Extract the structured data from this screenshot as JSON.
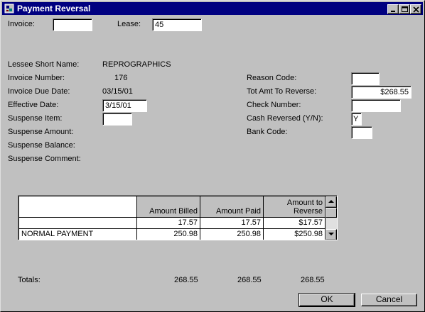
{
  "window": {
    "title": "Payment Reversal",
    "minimize_icon": "minimize-icon",
    "maximize_icon": "maximize-icon",
    "close_icon": "close-icon"
  },
  "header": {
    "invoice_label": "Invoice:",
    "invoice_value": "",
    "lease_label": "Lease:",
    "lease_value": "45"
  },
  "left": {
    "lessee_short_name_label": "Lessee Short Name:",
    "lessee_short_name_value": "REPROGRAPHICS",
    "invoice_number_label": "Invoice Number:",
    "invoice_number_value": "176",
    "invoice_due_date_label": "Invoice Due Date:",
    "invoice_due_date_value": "03/15/01",
    "effective_date_label": "Effective Date:",
    "effective_date_value": "3/15/01",
    "suspense_item_label": "Suspense Item:",
    "suspense_item_value": "",
    "suspense_amount_label": "Suspense Amount:",
    "suspense_balance_label": "Suspense Balance:",
    "suspense_comment_label": "Suspense Comment:"
  },
  "right": {
    "reason_code_label": "Reason Code:",
    "reason_code_value": "",
    "tot_amt_label": "Tot Amt To Reverse:",
    "tot_amt_value": "$268.55",
    "check_number_label": "Check Number:",
    "check_number_value": "",
    "cash_reversed_label": "Cash Reversed (Y/N):",
    "cash_reversed_value": "Y",
    "bank_code_label": "Bank Code:",
    "bank_code_value": ""
  },
  "grid": {
    "columns": [
      "",
      "Amount Billed",
      "Amount Paid",
      "Amount to Reverse"
    ],
    "rows": [
      [
        "",
        "17.57",
        "17.57",
        "$17.57"
      ],
      [
        "NORMAL PAYMENT",
        "250.98",
        "250.98",
        "$250.98"
      ]
    ]
  },
  "totals": {
    "label": "Totals:",
    "billed": "268.55",
    "paid": "268.55",
    "reverse": "268.55"
  },
  "buttons": {
    "ok": "OK",
    "cancel": "Cancel"
  }
}
